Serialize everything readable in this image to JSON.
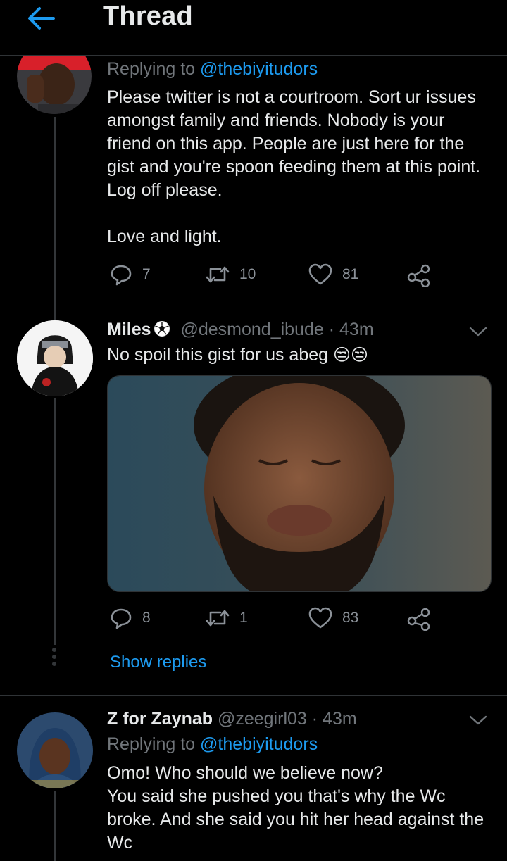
{
  "header": {
    "title": "Thread"
  },
  "tweets": [
    {
      "replying_prefix": "Replying to ",
      "replying_handle": "@thebiyitudors",
      "lines": [
        "Please twitter is not a courtroom. Sort ur issues",
        "amongst family and friends. Nobody is your",
        "friend on this app. People are just here for the",
        "gist and you're spoon feeding them at this point.",
        "Log off please.",
        "",
        "Love and light."
      ],
      "replies": "7",
      "retweets": "10",
      "likes": "81"
    },
    {
      "name": "Miles",
      "handle": "@desmond_ibude",
      "time": "· 43m",
      "text": "No spoil this gist for us abeg",
      "emoji": "😒😒",
      "replies": "8",
      "retweets": "1",
      "likes": "83",
      "show_replies": "Show replies"
    },
    {
      "name": "Z for Zaynab",
      "handle": "@zeegirl03",
      "time": "· 43m",
      "replying_prefix": "Replying to ",
      "replying_handle": "@thebiyitudors",
      "lines": [
        "Omo! Who should we believe now?",
        "You said she pushed you that's why the Wc",
        "broke. And she said you hit her head against the",
        "Wc"
      ]
    }
  ],
  "colors": {
    "accent": "#1d9bf0",
    "muted": "#71767b",
    "background": "#000000"
  },
  "icons": [
    "back-arrow-icon",
    "reply-icon",
    "retweet-icon",
    "like-icon",
    "share-icon",
    "chevron-down-icon",
    "soccer-ball-icon",
    "more-dots-icon"
  ]
}
